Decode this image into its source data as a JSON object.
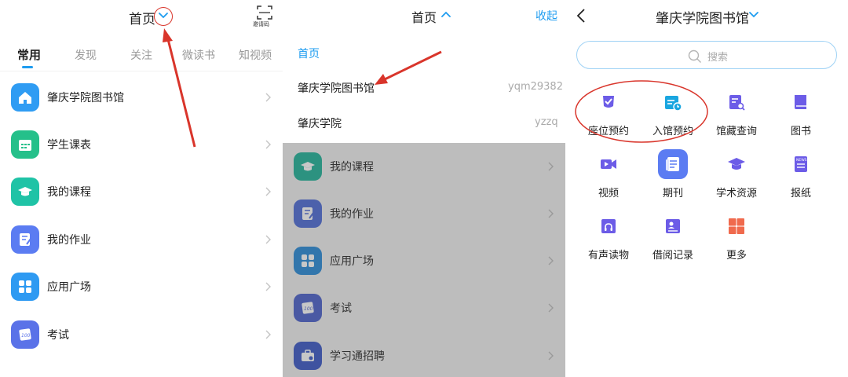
{
  "panel1": {
    "title": "首页",
    "scan_label": "邀请码",
    "tabs": [
      "常用",
      "发现",
      "关注",
      "微读书",
      "知视频"
    ],
    "rows": [
      "肇庆学院图书馆",
      "学生课表",
      "我的课程",
      "我的作业",
      "应用广场",
      "考试"
    ]
  },
  "panel2": {
    "title": "首页",
    "collapse_label": "收起",
    "menu": [
      {
        "label": "首页",
        "code": ""
      },
      {
        "label": "肇庆学院图书馆",
        "code": "yqm29382"
      },
      {
        "label": "肇庆学院",
        "code": "yzzq"
      }
    ],
    "rows": [
      "我的课程",
      "我的作业",
      "应用广场",
      "考试",
      "学习通招聘"
    ]
  },
  "panel3": {
    "title": "肇庆学院图书馆",
    "search_placeholder": "搜索",
    "grid": [
      "座位预约",
      "入馆预约",
      "馆藏查询",
      "图书",
      "视频",
      "期刊",
      "学术资源",
      "报纸",
      "有声读物",
      "借阅记录",
      "更多"
    ]
  },
  "colors": {
    "accent": "#1e9cf0",
    "annotation_red": "#d9352b",
    "overlay": "#bdbdbd"
  },
  "icons": {
    "panel1_rows": [
      "home-icon",
      "calendar-icon",
      "graduation-cap-icon",
      "pencil-note-icon",
      "grid-icon",
      "exam-icon"
    ],
    "panel2_rows": [
      "graduation-cap-icon",
      "pencil-note-icon",
      "grid-icon",
      "exam-icon",
      "briefcase-icon"
    ],
    "panel3_grid": [
      "seat-booking-icon",
      "entry-booking-icon",
      "catalog-search-icon",
      "book-icon",
      "video-icon",
      "journal-icon",
      "academic-resources-icon",
      "newspaper-icon",
      "audiobook-icon",
      "borrow-record-icon",
      "more-icon"
    ]
  }
}
